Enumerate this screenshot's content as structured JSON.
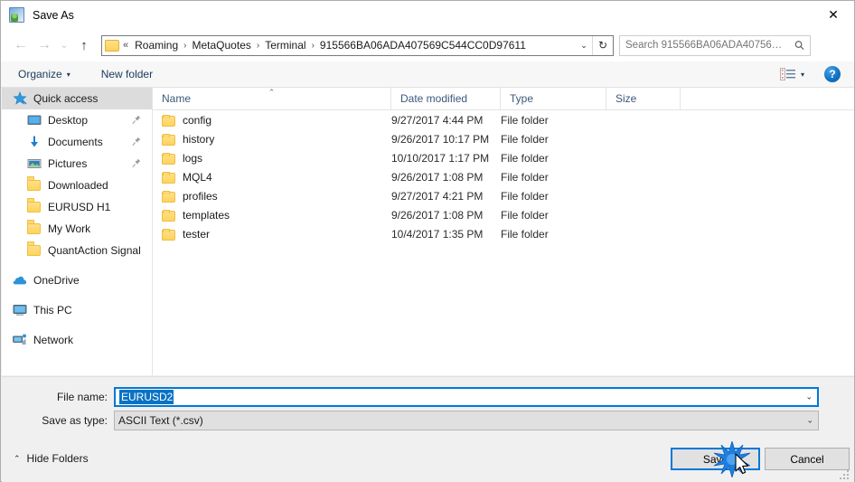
{
  "window": {
    "title": "Save As",
    "icon": "save-as-app-icon",
    "close_label": "✕"
  },
  "nav": {
    "back": "←",
    "forward": "→",
    "recent": "⌄",
    "up": "↑",
    "back_enabled": false,
    "forward_enabled": false,
    "up_enabled": true
  },
  "address": {
    "overflow": "«",
    "crumbs": [
      "Roaming",
      "MetaQuotes",
      "Terminal",
      "915566BA06ADA407569C544CC0D97611"
    ],
    "separator": "›",
    "dropdown": "⌄",
    "refresh": "↻"
  },
  "search": {
    "placeholder": "Search 915566BA06ADA40756…",
    "value": ""
  },
  "toolbar": {
    "organize_label": "Organize",
    "organize_caret": "▾",
    "new_folder_label": "New folder",
    "view_caret": "▾",
    "help_label": "?"
  },
  "sidebar": {
    "items": [
      {
        "label": "Quick access",
        "icon": "star-pin-icon",
        "indent": "root",
        "selected": true,
        "pinned": false
      },
      {
        "label": "Desktop",
        "icon": "desktop-icon",
        "indent": "child",
        "selected": false,
        "pinned": true
      },
      {
        "label": "Documents",
        "icon": "documents-download-icon",
        "indent": "child",
        "selected": false,
        "pinned": true
      },
      {
        "label": "Pictures",
        "icon": "pictures-icon",
        "indent": "child",
        "selected": false,
        "pinned": true
      },
      {
        "label": "Downloaded",
        "icon": "folder-icon",
        "indent": "child",
        "selected": false,
        "pinned": false
      },
      {
        "label": "EURUSD H1",
        "icon": "folder-icon",
        "indent": "child",
        "selected": false,
        "pinned": false
      },
      {
        "label": "My Work",
        "icon": "folder-icon",
        "indent": "child",
        "selected": false,
        "pinned": false
      },
      {
        "label": "QuantAction Signal",
        "icon": "folder-icon",
        "indent": "child",
        "selected": false,
        "pinned": false
      },
      {
        "label": "OneDrive",
        "icon": "onedrive-cloud-icon",
        "indent": "root",
        "selected": false,
        "pinned": false,
        "gap_before": true
      },
      {
        "label": "This PC",
        "icon": "this-pc-icon",
        "indent": "root",
        "selected": false,
        "pinned": false,
        "gap_before": true
      },
      {
        "label": "Network",
        "icon": "network-icon",
        "indent": "root",
        "selected": false,
        "pinned": false,
        "gap_before": true
      }
    ]
  },
  "filelist": {
    "columns": [
      {
        "label": "Name",
        "sorted": true,
        "sort_caret": "⌃"
      },
      {
        "label": "Date modified",
        "sorted": false
      },
      {
        "label": "Type",
        "sorted": false
      },
      {
        "label": "Size",
        "sorted": false
      }
    ],
    "rows": [
      {
        "name": "config",
        "date_modified": "9/27/2017 4:44 PM",
        "type": "File folder",
        "size": ""
      },
      {
        "name": "history",
        "date_modified": "9/26/2017 10:17 PM",
        "type": "File folder",
        "size": ""
      },
      {
        "name": "logs",
        "date_modified": "10/10/2017 1:17 PM",
        "type": "File folder",
        "size": ""
      },
      {
        "name": "MQL4",
        "date_modified": "9/26/2017 1:08 PM",
        "type": "File folder",
        "size": ""
      },
      {
        "name": "profiles",
        "date_modified": "9/27/2017 4:21 PM",
        "type": "File folder",
        "size": ""
      },
      {
        "name": "templates",
        "date_modified": "9/26/2017 1:08 PM",
        "type": "File folder",
        "size": ""
      },
      {
        "name": "tester",
        "date_modified": "10/4/2017 1:35 PM",
        "type": "File folder",
        "size": ""
      }
    ]
  },
  "form": {
    "filename_label": "File name:",
    "filename_value": "EURUSD2",
    "filename_selected": true,
    "filetype_label": "Save as type:",
    "filetype_value": "ASCII Text (*.csv)",
    "caret": "⌄"
  },
  "footer": {
    "hide_folders_label": "Hide Folders",
    "hide_folders_caret": "⌃",
    "save_label": "Save",
    "cancel_label": "Cancel"
  },
  "colors": {
    "accent": "#0078d7",
    "selection_blue": "#0a72c4",
    "folder_yellow": "#ffd35c",
    "header_text": "#3b5a7a",
    "dialog_bg": "#f0f0f0"
  },
  "pointer": {
    "click_effect": "click-burst",
    "cursor": "arrow-cursor"
  }
}
